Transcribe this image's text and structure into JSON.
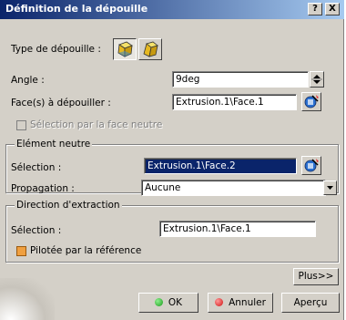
{
  "window": {
    "title": "Définition de la dépouille",
    "help_label": "?",
    "close_label": "X"
  },
  "draft_type": {
    "label": "Type de dépouille :"
  },
  "angle": {
    "label": "Angle :",
    "value": "9deg"
  },
  "faces": {
    "label": "Face(s) à dépouiller :",
    "value": "Extrusion.1\\Face.1"
  },
  "neutral_face_option": {
    "label": "Sélection par la face neutre"
  },
  "neutral_element": {
    "title": "Elément neutre",
    "selection_label": "Sélection :",
    "selection_value": "Extrusion.1\\Face.2",
    "propagation_label": "Propagation :",
    "propagation_value": "Aucune"
  },
  "pull_direction": {
    "title": "Direction d'extraction",
    "selection_label": "Sélection :",
    "selection_value": "Extrusion.1\\Face.1",
    "controlled_label": "Pilotée par la référence"
  },
  "buttons": {
    "more": "Plus>>",
    "ok": "OK",
    "cancel": "Annuler",
    "preview": "Aperçu"
  },
  "colors": {
    "title_bar": "#0a246a",
    "ok_icon": "#1a9a1a",
    "cancel_icon": "#d01010",
    "checkbox_checked": "#f0a040"
  }
}
